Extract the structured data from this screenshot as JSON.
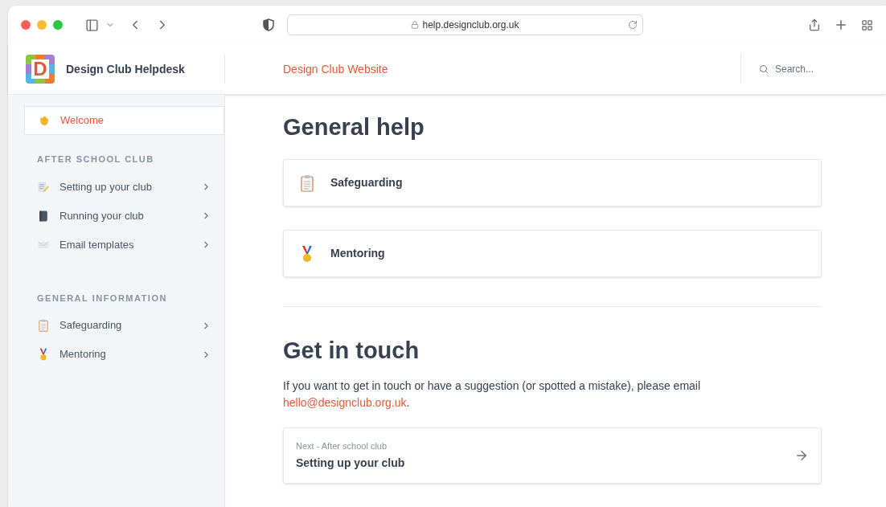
{
  "browser": {
    "url": "help.designclub.org.uk"
  },
  "header": {
    "logo_letter": "D",
    "title": "Design Club Helpdesk",
    "website_link": "Design Club Website",
    "search": {
      "placeholder": "Search..."
    }
  },
  "sidebar": {
    "welcome": {
      "label": "Welcome",
      "kind": "hand",
      "selected": true
    },
    "sections": [
      {
        "heading": "AFTER SCHOOL CLUB",
        "items": [
          {
            "label": "Setting up your club",
            "kind": "notepad",
            "selected": false
          },
          {
            "label": "Running your club",
            "kind": "notebook",
            "selected": false
          },
          {
            "label": "Email templates",
            "kind": "envelope",
            "selected": false
          }
        ]
      },
      {
        "heading": "GENERAL INFORMATION",
        "items": [
          {
            "label": "Safeguarding",
            "kind": "clipboard",
            "selected": false
          },
          {
            "label": "Mentoring",
            "kind": "medal",
            "selected": false
          }
        ]
      }
    ]
  },
  "content": {
    "general_help": {
      "title": "General help",
      "cards": [
        {
          "label": "Safeguarding",
          "kind": "clipboard"
        },
        {
          "label": "Mentoring",
          "kind": "medal"
        }
      ]
    },
    "get_in_touch": {
      "title": "Get in touch",
      "text": "If you want to get in touch or have a suggestion (or spotted a mistake), please email",
      "email": "hello@designclub.org.uk",
      "after": "."
    },
    "next": {
      "caption": "Next - After school club",
      "title": "Setting up your club"
    }
  }
}
